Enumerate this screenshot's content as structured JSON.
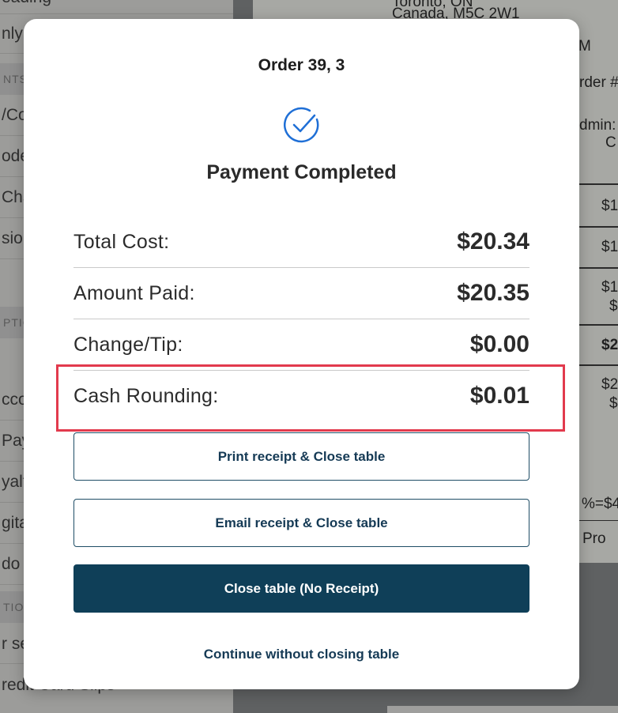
{
  "background": {
    "sidebar": {
      "rows": [
        "eading",
        "nly I",
        "/Co",
        "ode",
        "Char",
        "sion",
        "cco",
        "Pay",
        "yalt",
        "gita",
        "do P",
        "r se",
        "redit Card Slips"
      ],
      "sections": [
        "NTS",
        "PTIC",
        "TION"
      ]
    },
    "receipt": {
      "address_line1": "Toronto, ON",
      "address_line2": "Canada, M5C 2W1",
      "fragments": [
        "M",
        "rder #",
        "dmin:",
        "C",
        "$1",
        "$1",
        "$1",
        "$",
        "$2",
        "$2",
        "$",
        "%=$4",
        "Pro"
      ]
    }
  },
  "modal": {
    "title": "Order 39, 3",
    "status": "Payment Completed",
    "summary": [
      {
        "label": "Total Cost:",
        "value": "$20.34"
      },
      {
        "label": "Amount Paid:",
        "value": "$20.35"
      },
      {
        "label": "Change/Tip:",
        "value": "$0.00"
      },
      {
        "label": "Cash Rounding:",
        "value": "$0.01"
      }
    ],
    "buttons": {
      "print": "Print receipt & Close table",
      "email": "Email receipt & Close table",
      "close": "Close table (No Receipt)",
      "continue": "Continue without closing table"
    }
  },
  "colors": {
    "accent": "#1f6fd6",
    "primary_button": "#0f3f58",
    "highlight": "#e23a4d"
  },
  "icons": {
    "status": "check-circle-icon"
  }
}
